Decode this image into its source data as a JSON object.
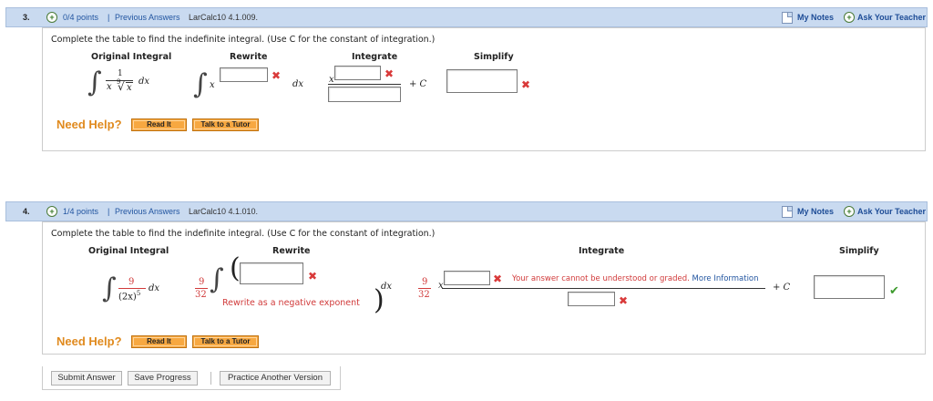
{
  "common": {
    "plus_glyph": "+",
    "x_glyph": "✖",
    "check_glyph": "✔",
    "plus_c": "+ C",
    "dx": "dx",
    "x_var": "x",
    "integral": "∫"
  },
  "q3": {
    "number": "3.",
    "points": "0/4 points",
    "separator": "|",
    "previous_answers": "Previous Answers",
    "ref": "LarCalc10 4.1.009.",
    "my_notes": "My Notes",
    "ask_teacher": "Ask Your Teacher",
    "instruction": "Complete the table to find the indefinite integral. (Use C for the constant of integration.)",
    "headers": [
      "Original Integral",
      "Rewrite",
      "Integrate",
      "Simplify"
    ],
    "original": {
      "numerator": "1",
      "den_x": "x",
      "root_index": "9",
      "radical": "√",
      "den_radicand": "x"
    },
    "rewrite_base": "x",
    "rewrite_value": "",
    "integrate_exponent_value": "",
    "integrate_denominator_value": "",
    "simplify_value": "",
    "need_help": "Need Help?",
    "read_it": "Read It",
    "talk_tutor": "Talk to a Tutor"
  },
  "q4": {
    "number": "4.",
    "points": "1/4 points",
    "separator": "|",
    "previous_answers": "Previous Answers",
    "ref": "LarCalc10 4.1.010.",
    "my_notes": "My Notes",
    "ask_teacher": "Ask Your Teacher",
    "instruction": "Complete the table to find the indefinite integral. (Use C for the constant of integration.)",
    "headers": [
      "Original Integral",
      "Rewrite",
      "Integrate",
      "Simplify"
    ],
    "original": {
      "numerator": "9",
      "denominator": "(2x)",
      "den_exp": "5"
    },
    "coef_num": "9",
    "coef_den": "32",
    "paren_open": "(",
    "paren_close": ")",
    "rewrite_value": "",
    "rewrite_hint": "Rewrite as a negative exponent",
    "integrate_exponent_value": "",
    "integrate_denominator_value": "",
    "error_message": "Your answer cannot be understood or graded.",
    "more_info": "More Information",
    "simplify_value": "",
    "need_help": "Need Help?",
    "read_it": "Read It",
    "talk_tutor": "Talk to a Tutor"
  },
  "footer": {
    "submit": "Submit Answer",
    "save": "Save Progress",
    "practice": "Practice Another Version"
  },
  "colors": {
    "header_bg": "#c9daf0",
    "link": "#2255a0",
    "error": "#d93a3a",
    "correct": "#3c9a2c",
    "help_orange": "#e08a1e",
    "button_orange": "#f7a841"
  }
}
